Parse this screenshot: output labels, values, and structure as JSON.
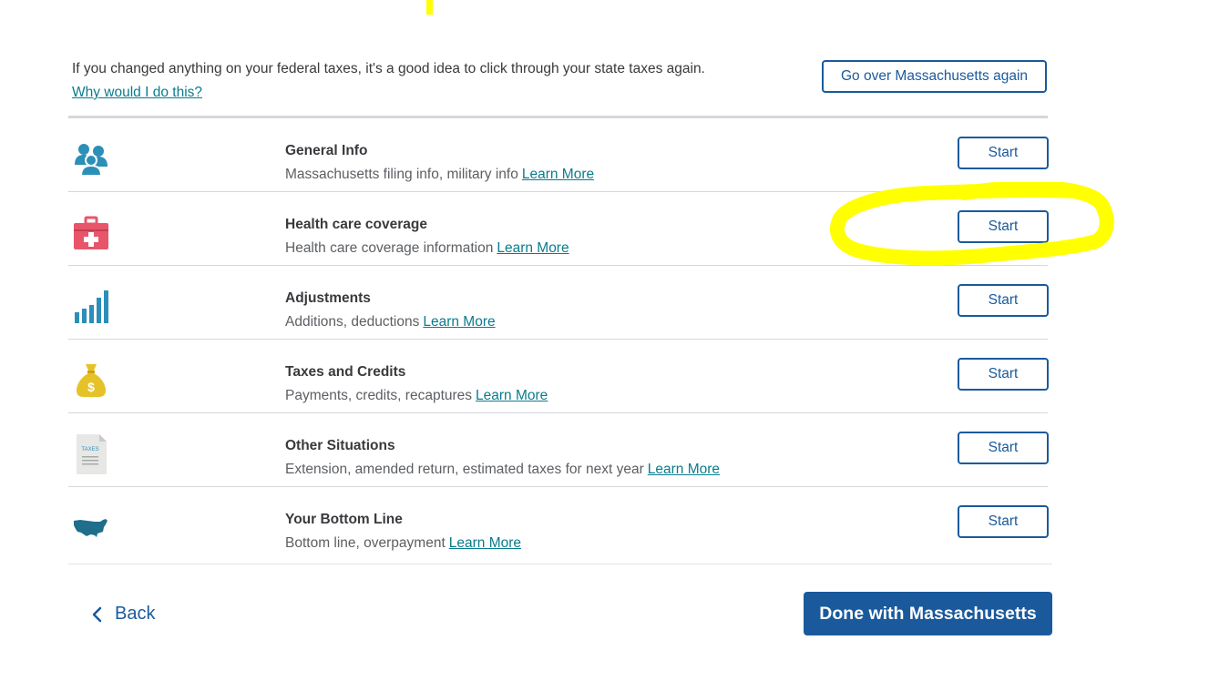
{
  "intro": {
    "text": "If you changed anything on your federal taxes, it's a good idea to click through your state taxes again.",
    "link": "Why would I do this?",
    "go_over_button": "Go over Massachusetts again"
  },
  "sections": [
    {
      "title": "General Info",
      "subtitle": "Massachusetts filing info, military info",
      "link": "Learn More",
      "button": "Start",
      "icon": "people-icon"
    },
    {
      "title": "Health care coverage",
      "subtitle": "Health care coverage information",
      "link": "Learn More",
      "button": "Start",
      "icon": "first-aid-kit-icon"
    },
    {
      "title": "Adjustments",
      "subtitle": "Additions, deductions",
      "link": "Learn More",
      "button": "Start",
      "icon": "bar-chart-icon"
    },
    {
      "title": "Taxes and Credits",
      "subtitle": "Payments, credits, recaptures",
      "link": "Learn More",
      "button": "Start",
      "icon": "money-bag-icon"
    },
    {
      "title": "Other Situations",
      "subtitle": "Extension, amended return, estimated taxes for next year",
      "link": "Learn More",
      "button": "Start",
      "icon": "tax-document-icon"
    },
    {
      "title": "Your Bottom Line",
      "subtitle": "Bottom line, overpayment",
      "link": "Learn More",
      "button": "Start",
      "icon": "usa-map-icon"
    }
  ],
  "tax_doc_label": "TAXES",
  "footer": {
    "back_label": "Back",
    "done_label": "Done with Massachusetts"
  },
  "colors": {
    "primary": "#1a5a9c",
    "link": "#0a7c8c",
    "annotation": "#ffff00"
  }
}
